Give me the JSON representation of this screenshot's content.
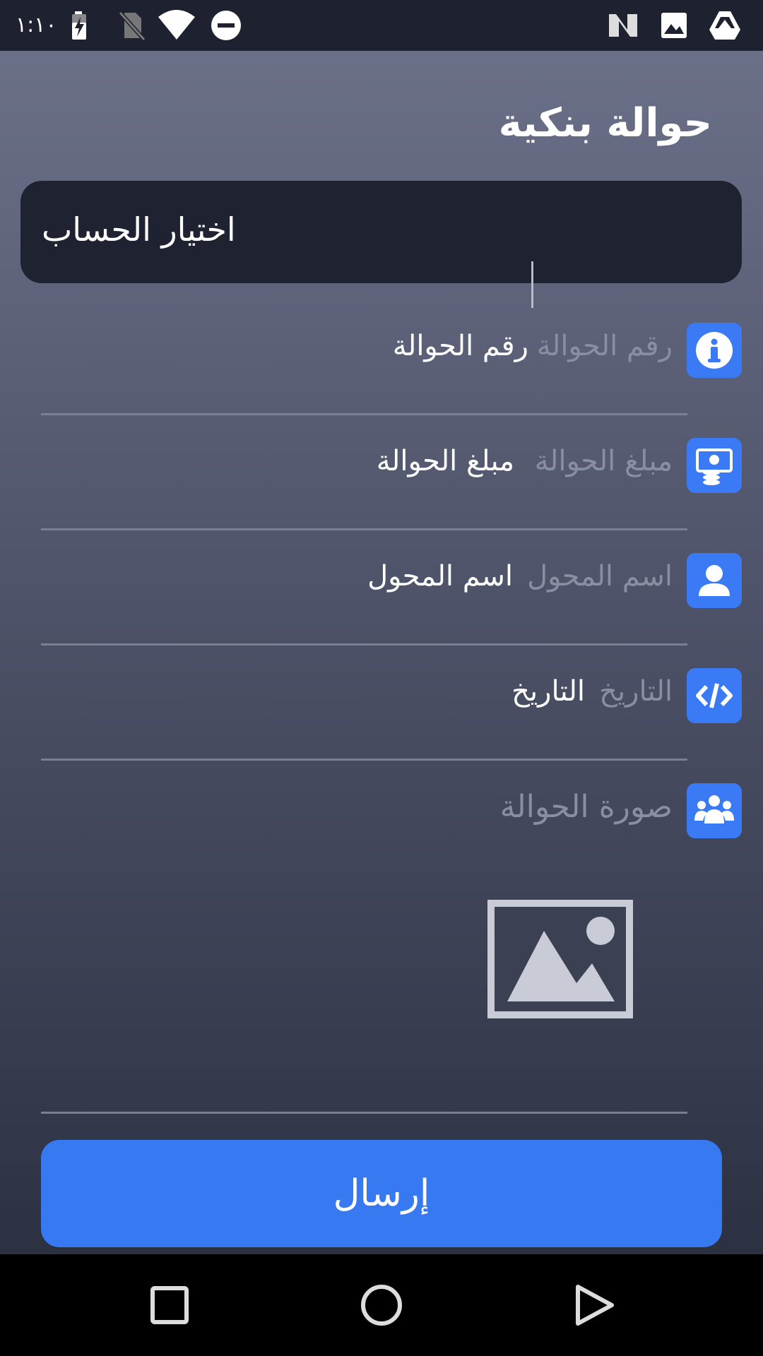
{
  "status_bar": {
    "time": "١:١٠",
    "icons": [
      "battery-charging-icon",
      "no-sim-icon",
      "wifi-icon",
      "do-not-disturb-icon",
      "n-notification-icon",
      "image-notification-icon",
      "drive-icon"
    ]
  },
  "page": {
    "title": "حوالة بنكية"
  },
  "account_select": {
    "label": "اختيار الحساب"
  },
  "fields": [
    {
      "id": "transfer-number",
      "label": "رقم الحوالة",
      "value": "رقم الحوالة",
      "icon": "info-icon"
    },
    {
      "id": "transfer-amount",
      "label": "مبلغ الحوالة",
      "value": "مبلغ الحوالة",
      "icon": "money-icon"
    },
    {
      "id": "sender-name",
      "label": "اسم المحول",
      "value": "اسم المحول",
      "icon": "user-icon"
    },
    {
      "id": "date",
      "label": "التاريخ",
      "value": "التاريخ",
      "icon": "code-icon"
    },
    {
      "id": "transfer-image",
      "label": "صورة الحوالة",
      "icon": "group-icon"
    }
  ],
  "submit_button": {
    "label": "إرسال"
  },
  "nav_bar": {
    "buttons": [
      "recents-icon",
      "home-icon",
      "back-icon"
    ]
  },
  "colors": {
    "accent": "#3779f1",
    "status_bar": "#1e2130",
    "account_box": "#1f2230"
  }
}
